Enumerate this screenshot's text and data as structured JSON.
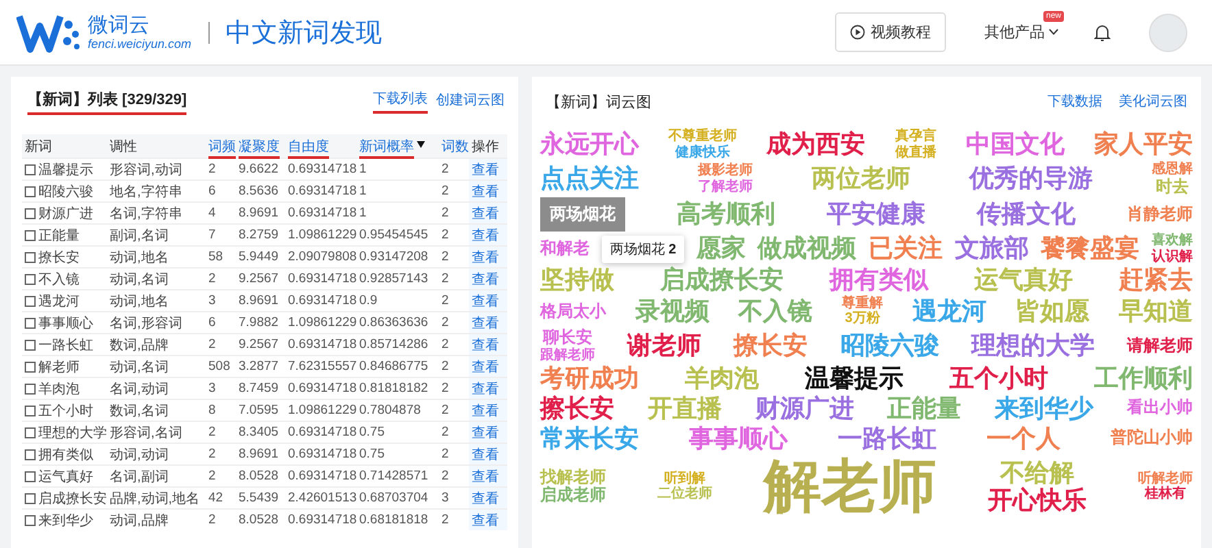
{
  "header": {
    "logo_name": "微词云",
    "logo_domain": "fenci.weiciyun.com",
    "page_title": "中文新词发现",
    "tutorial_button": "视频教程",
    "products_menu": "其他产品",
    "new_badge": "new"
  },
  "list_panel": {
    "title": "【新词】列表 [329/329]",
    "title_marked": true,
    "links": [
      {
        "label": "下载列表",
        "marked": true
      },
      {
        "label": "创建词云图",
        "marked": false
      }
    ],
    "columns": [
      {
        "label": "新词",
        "sortable": false,
        "marked": false,
        "sorted": false
      },
      {
        "label": "调性",
        "sortable": false,
        "marked": false,
        "sorted": false
      },
      {
        "label": "词频",
        "sortable": true,
        "marked": true,
        "sorted": false
      },
      {
        "label": "凝聚度",
        "sortable": true,
        "marked": true,
        "sorted": false
      },
      {
        "label": "自由度",
        "sortable": true,
        "marked": true,
        "sorted": false
      },
      {
        "label": "新词概率",
        "sortable": true,
        "marked": true,
        "sorted": true
      },
      {
        "label": "词数",
        "sortable": true,
        "marked": false,
        "sorted": false
      },
      {
        "label": "操作",
        "sortable": false,
        "marked": false,
        "sorted": false
      }
    ],
    "rows": [
      {
        "checked": false,
        "cells": [
          "温馨提示",
          "形容词,动词",
          "2",
          "9.6622",
          "0.69314718",
          "1",
          "2"
        ],
        "action": "查看"
      },
      {
        "checked": false,
        "cells": [
          "昭陵六骏",
          "地名,字符串",
          "6",
          "8.5636",
          "0.69314718",
          "1",
          "2"
        ],
        "action": "查看"
      },
      {
        "checked": false,
        "cells": [
          "财源广进",
          "名词,字符串",
          "4",
          "8.9691",
          "0.69314718",
          "1",
          "2"
        ],
        "action": "查看"
      },
      {
        "checked": false,
        "cells": [
          "正能量",
          "副词,名词",
          "7",
          "8.2759",
          "1.09861229",
          "0.95454545",
          "2"
        ],
        "action": "查看"
      },
      {
        "checked": false,
        "cells": [
          "撩长安",
          "动词,地名",
          "58",
          "5.9449",
          "2.09079808",
          "0.93147208",
          "2"
        ],
        "action": "查看"
      },
      {
        "checked": false,
        "cells": [
          "不入镜",
          "动词,名词",
          "2",
          "9.2567",
          "0.69314718",
          "0.92857143",
          "2"
        ],
        "action": "查看"
      },
      {
        "checked": false,
        "cells": [
          "遇龙河",
          "动词,地名",
          "3",
          "8.9691",
          "0.69314718",
          "0.9",
          "2"
        ],
        "action": "查看"
      },
      {
        "checked": false,
        "cells": [
          "事事顺心",
          "名词,形容词",
          "6",
          "7.9882",
          "1.09861229",
          "0.86363636",
          "2"
        ],
        "action": "查看"
      },
      {
        "checked": false,
        "cells": [
          "一路长虹",
          "数词,品牌",
          "2",
          "9.2567",
          "0.69314718",
          "0.85714286",
          "2"
        ],
        "action": "查看"
      },
      {
        "checked": false,
        "cells": [
          "解老师",
          "动词,名词",
          "508",
          "3.2877",
          "7.62315557",
          "0.84686775",
          "2"
        ],
        "action": "查看"
      },
      {
        "checked": false,
        "cells": [
          "羊肉泡",
          "名词,动词",
          "3",
          "8.7459",
          "0.69314718",
          "0.81818182",
          "2"
        ],
        "action": "查看"
      },
      {
        "checked": false,
        "cells": [
          "五个小时",
          "数词,名词",
          "8",
          "7.0595",
          "1.09861229",
          "0.7804878",
          "2"
        ],
        "action": "查看"
      },
      {
        "checked": false,
        "cells": [
          "理想的大学",
          "形容词,名词",
          "2",
          "8.3405",
          "0.69314718",
          "0.75",
          "2"
        ],
        "action": "查看"
      },
      {
        "checked": false,
        "cells": [
          "拥有类似",
          "动词,动词",
          "2",
          "8.9691",
          "0.69314718",
          "0.75",
          "2"
        ],
        "action": "查看"
      },
      {
        "checked": false,
        "cells": [
          "运气真好",
          "名词,副词",
          "2",
          "8.0528",
          "0.69314718",
          "0.71428571",
          "2"
        ],
        "action": "查看"
      },
      {
        "checked": false,
        "cells": [
          "启成撩长安",
          "品牌,动词,地名",
          "42",
          "5.5439",
          "2.42601513",
          "0.68703704",
          "3"
        ],
        "action": "查看"
      },
      {
        "checked": false,
        "cells": [
          "来到华少",
          "动词,品牌",
          "2",
          "8.0528",
          "0.69314718",
          "0.68181818",
          "2"
        ],
        "action": "查看"
      }
    ]
  },
  "cloud_panel": {
    "title": "【新词】词云图",
    "links": [
      {
        "label": "下载数据"
      },
      {
        "label": "美化词云图"
      }
    ],
    "rows": [
      {
        "items": [
          {
            "kind": "big",
            "text": "永远开心",
            "color": "#e066e0"
          },
          {
            "kind": "stack",
            "words": [
              {
                "kind": "small",
                "text": "不尊重老师",
                "color": "#d4b020"
              },
              {
                "kind": "small",
                "text": "健康快乐",
                "color": "#3aa8e8"
              }
            ]
          },
          {
            "kind": "big",
            "text": "成为西安",
            "color": "#e0204a"
          },
          {
            "kind": "stack",
            "words": [
              {
                "kind": "small",
                "text": "真孕言",
                "color": "#d4b020"
              },
              {
                "kind": "small",
                "text": "做直播",
                "color": "#d4b020"
              }
            ]
          },
          {
            "kind": "big",
            "text": "中国文化",
            "color": "#e066e0"
          },
          {
            "kind": "big",
            "text": "家人平安",
            "color": "#f08050"
          }
        ]
      },
      {
        "items": [
          {
            "kind": "big",
            "text": "点点关注",
            "color": "#3aa8e8"
          },
          {
            "kind": "stack",
            "words": [
              {
                "kind": "small",
                "text": "摄影老师",
                "color": "#f08050"
              },
              {
                "kind": "small",
                "text": "了解老师",
                "color": "#e066e0"
              }
            ]
          },
          {
            "kind": "big",
            "text": "两位老师",
            "color": "#b8c050"
          },
          {
            "kind": "big",
            "text": "优秀的导游",
            "color": "#9a70e0"
          },
          {
            "kind": "stack",
            "words": [
              {
                "kind": "small",
                "text": "感恩解",
                "color": "#f08050"
              },
              {
                "kind": "medium",
                "text": "时去",
                "color": "#b8c050"
              }
            ]
          }
        ]
      },
      {
        "items": [
          {
            "kind": "highlight",
            "text": "两场烟花",
            "color": "#8c8c8c"
          },
          {
            "kind": "big",
            "text": "高考顺利",
            "color": "#80b870"
          },
          {
            "kind": "big",
            "text": "平安健康",
            "color": "#9a70e0"
          },
          {
            "kind": "big",
            "text": "传播文化",
            "color": "#9a70e0"
          },
          {
            "kind": "medium",
            "text": "肖静老师",
            "color": "#f08050"
          }
        ]
      },
      {
        "items": [
          {
            "kind": "medium",
            "text": "和解老",
            "color": "#e066e0"
          },
          {
            "kind": "tooltip",
            "text": "两场烟花",
            "count": "2"
          },
          {
            "kind": "big",
            "text": "愿家",
            "color": "#80b870"
          },
          {
            "kind": "big",
            "text": "做成视频",
            "color": "#80b870"
          },
          {
            "kind": "big",
            "text": "已关注",
            "color": "#f08050"
          },
          {
            "kind": "big",
            "text": "文旅部",
            "color": "#9a70e0"
          },
          {
            "kind": "big",
            "text": "饕餮盛宴",
            "color": "#f08050"
          },
          {
            "kind": "stack",
            "words": [
              {
                "kind": "small",
                "text": "喜欢解",
                "color": "#80b870"
              },
              {
                "kind": "small",
                "text": "认识解",
                "color": "#e0204a"
              }
            ]
          }
        ]
      },
      {
        "items": [
          {
            "kind": "big",
            "text": "坚持做",
            "color": "#b8c050"
          },
          {
            "kind": "big",
            "text": "启成撩长安",
            "color": "#80b870"
          },
          {
            "kind": "big",
            "text": "拥有类似",
            "color": "#e066e0"
          },
          {
            "kind": "big",
            "text": "运气真好",
            "color": "#b8c050"
          },
          {
            "kind": "big",
            "text": "赶紧去",
            "color": "#f08050"
          }
        ]
      },
      {
        "items": [
          {
            "kind": "medium",
            "text": "格局太小",
            "color": "#e066e0"
          },
          {
            "kind": "big",
            "text": "录视频",
            "color": "#80b870"
          },
          {
            "kind": "big",
            "text": "不入镜",
            "color": "#80b870"
          },
          {
            "kind": "stack",
            "words": [
              {
                "kind": "small",
                "text": "尊重解",
                "color": "#f08050"
              },
              {
                "kind": "small",
                "text": "3万粉",
                "color": "#d4b020"
              }
            ]
          },
          {
            "kind": "big",
            "text": "遇龙河",
            "color": "#3aa8e8"
          },
          {
            "kind": "big",
            "text": "皆如愿",
            "color": "#b8c050"
          },
          {
            "kind": "big",
            "text": "早知道",
            "color": "#b8c050"
          }
        ]
      },
      {
        "items": [
          {
            "kind": "stack",
            "words": [
              {
                "kind": "medium",
                "text": "聊长安",
                "color": "#e066e0"
              },
              {
                "kind": "small",
                "text": "跟解老师",
                "color": "#e066e0"
              }
            ]
          },
          {
            "kind": "big",
            "text": "谢老师",
            "color": "#e0204a"
          },
          {
            "kind": "big",
            "text": "撩长安",
            "color": "#f08050"
          },
          {
            "kind": "big",
            "text": "昭陵六骏",
            "color": "#3aa8e8"
          },
          {
            "kind": "big",
            "text": "理想的大学",
            "color": "#9a70e0"
          },
          {
            "kind": "medium",
            "text": "请解老师",
            "color": "#e0204a"
          }
        ]
      },
      {
        "items": [
          {
            "kind": "big",
            "text": "考研成功",
            "color": "#f08050"
          },
          {
            "kind": "big",
            "text": "羊肉泡",
            "color": "#b8c050"
          },
          {
            "kind": "big",
            "text": "温馨提示",
            "color": "#111111"
          },
          {
            "kind": "big",
            "text": "五个小时",
            "color": "#e0204a"
          },
          {
            "kind": "big",
            "text": "工作顺利",
            "color": "#80b870"
          }
        ]
      },
      {
        "items": [
          {
            "kind": "big",
            "text": "擦长安",
            "color": "#e0204a"
          },
          {
            "kind": "big",
            "text": "开直播",
            "color": "#b8c050"
          },
          {
            "kind": "big",
            "text": "财源广进",
            "color": "#9a70e0"
          },
          {
            "kind": "big",
            "text": "正能量",
            "color": "#80b870"
          },
          {
            "kind": "big",
            "text": "来到华少",
            "color": "#3aa8e8"
          },
          {
            "kind": "medium",
            "text": "看出小帅",
            "color": "#e066e0"
          }
        ]
      },
      {
        "items": [
          {
            "kind": "big",
            "text": "常来长安",
            "color": "#3aa8e8"
          },
          {
            "kind": "big",
            "text": "事事顺心",
            "color": "#e066e0"
          },
          {
            "kind": "big",
            "text": "一路长虹",
            "color": "#9a70e0"
          },
          {
            "kind": "big",
            "text": "一个人",
            "color": "#f08050"
          },
          {
            "kind": "medium",
            "text": "普陀山小帅",
            "color": "#f08050"
          }
        ]
      },
      {
        "items": [
          {
            "kind": "stack",
            "words": [
              {
                "kind": "medium",
                "text": "找解老师",
                "color": "#b8c050"
              },
              {
                "kind": "medium",
                "text": "启成老师",
                "color": "#80b870"
              }
            ]
          },
          {
            "kind": "stack",
            "words": [
              {
                "kind": "small",
                "text": "听到解",
                "color": "#d4b020"
              },
              {
                "kind": "small",
                "text": "二位老师",
                "color": "#b8c050"
              }
            ]
          },
          {
            "kind": "huge",
            "text": "解老师",
            "color": "#b8b050"
          },
          {
            "kind": "stack",
            "words": [
              {
                "kind": "big",
                "text": "不给解",
                "color": "#b8c050"
              },
              {
                "kind": "big",
                "text": "开心快乐",
                "color": "#e0204a"
              }
            ]
          },
          {
            "kind": "stack",
            "words": [
              {
                "kind": "small",
                "text": "听解老师",
                "color": "#f08050"
              },
              {
                "kind": "small",
                "text": "桂林有",
                "color": "#e0204a"
              }
            ]
          }
        ]
      }
    ]
  }
}
